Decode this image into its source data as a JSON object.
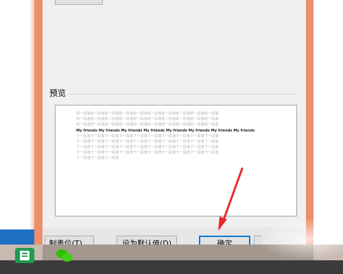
{
  "preview_section": {
    "label": "预览",
    "sample_lines": [
      {
        "kind": "prev",
        "text": "前一段落前一段落前一段落前一段落前一段落前一段落前一段落前一段落前一段落前一段落"
      },
      {
        "kind": "prev",
        "text": "前一段落前一段落前一段落前一段落前一段落前一段落前一段落前一段落前一段落前一段落"
      },
      {
        "kind": "prev",
        "text": "前一段落前一段落前一段落前一段落前一段落前一段落前一段落前一段落前一段落前一段落"
      },
      {
        "kind": "current",
        "text": "My friends My friends My friends My friends My friends My friends My friends My friends"
      },
      {
        "kind": "next",
        "text": "下一段落下一段落下一段落下一段落下一段落下一段落下一段落下一段落下一段落下一段落"
      },
      {
        "kind": "next",
        "text": "下一段落下一段落下一段落下一段落下一段落下一段落下一段落下一段落下一段落下一段落"
      },
      {
        "kind": "next",
        "text": "下一段落下一段落下一段落下一段落下一段落下一段落下一段落下一段落下一段落下一段落"
      },
      {
        "kind": "next",
        "text": "下一段落下一段落下一段落下一段落下一段落下一段落下一段落下一段落下一段落下一段落"
      },
      {
        "kind": "next",
        "text": "下一段落下一段落下一段落"
      }
    ]
  },
  "buttons": {
    "tab_stops": "制表位(T)...",
    "set_default": "设为默认值(D)",
    "ok": "确定"
  },
  "taskbar": {
    "apps": [
      {
        "icon": "spreadsheet-app-icon",
        "color": "#1e9b4f"
      },
      {
        "icon": "chat-app-icon",
        "color": "#2dc100"
      }
    ]
  },
  "colors": {
    "frame": "#ec8f6b",
    "dialog": "#f0f0f0",
    "arrow": "#e8282b",
    "accent": "#0078d7"
  }
}
